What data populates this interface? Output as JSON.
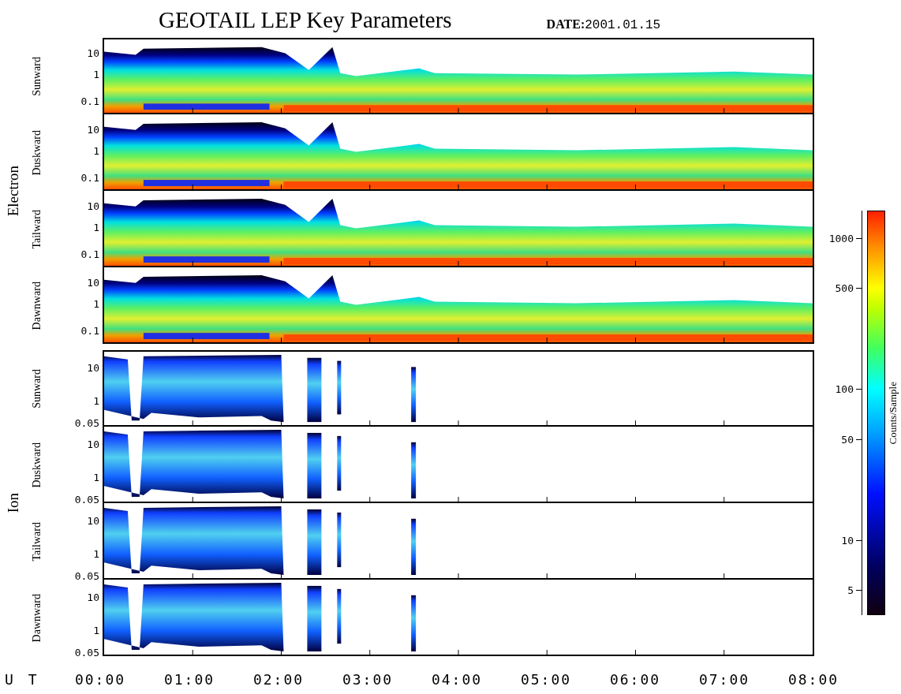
{
  "title": "GEOTAIL LEP Key Parameters",
  "date": "**DATE:**2001.01.15",
  "groups": [
    {
      "label": "Electron",
      "kind": "electron",
      "panels": [
        {
          "label": "Sunward",
          "yticks": [
            "10",
            "1",
            "0.1"
          ]
        },
        {
          "label": "Duskward",
          "yticks": [
            "10",
            "1",
            "0.1"
          ]
        },
        {
          "label": "Tailward",
          "yticks": [
            "10",
            "1",
            "0.1"
          ]
        },
        {
          "label": "Dawnward",
          "yticks": [
            "10",
            "1",
            "0.1"
          ]
        }
      ]
    },
    {
      "label": "Ion",
      "kind": "ion",
      "panels": [
        {
          "label": "Sunward",
          "yticks": [
            "10",
            "1",
            "0.05"
          ]
        },
        {
          "label": "Duskward",
          "yticks": [
            "10",
            "1",
            "0.05"
          ]
        },
        {
          "label": "Tailward",
          "yticks": [
            "10",
            "1",
            "0.05"
          ]
        },
        {
          "label": "Dawnward",
          "yticks": [
            "10",
            "1",
            "0.05"
          ]
        }
      ]
    }
  ],
  "x_axis": {
    "label": "U T",
    "ticks": [
      "00:00",
      "01:00",
      "02:00",
      "03:00",
      "04:00",
      "05:00",
      "06:00",
      "07:00",
      "08:00"
    ]
  },
  "colorbar": {
    "label": "Counts/Sample",
    "ticks": [
      "1000",
      "500",
      "100",
      "50",
      "10",
      "5"
    ]
  }
}
